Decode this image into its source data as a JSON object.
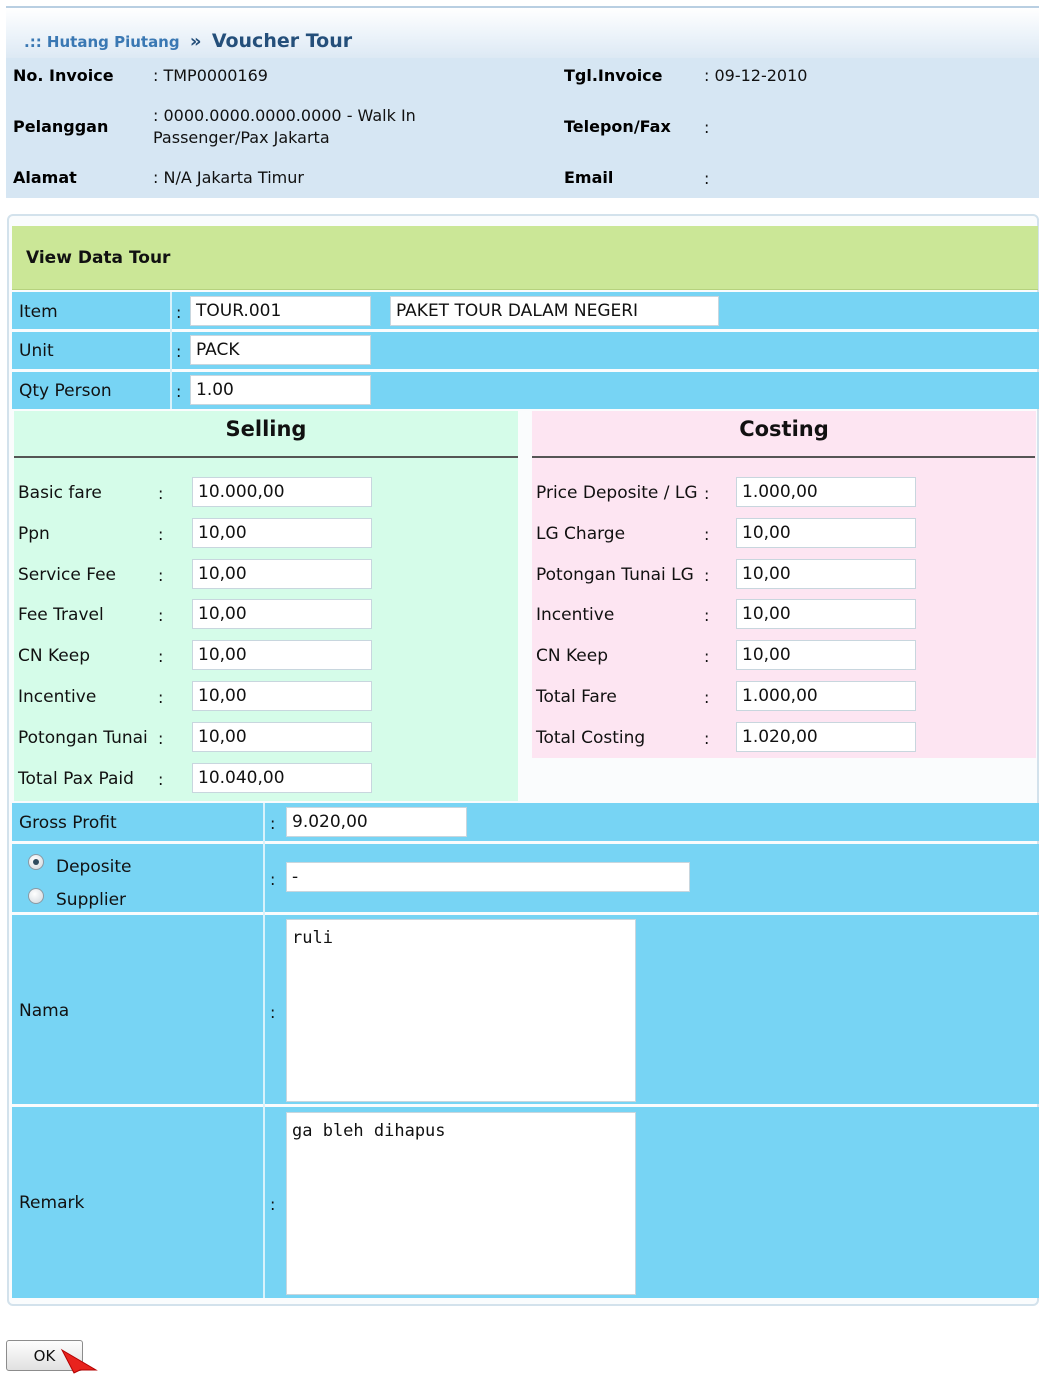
{
  "breadcrumb": {
    "prefix": ".:: Hutang Piutang",
    "separator": "»",
    "current": "Voucher Tour"
  },
  "header": {
    "no_invoice_label": "No. Invoice",
    "no_invoice_value": ": TMP0000169",
    "tgl_invoice_label": "Tgl.Invoice",
    "tgl_invoice_value": ": 09-12-2010",
    "pelanggan_label": "Pelanggan",
    "pelanggan_value_line1": ": 0000.0000.0000.0000 - Walk In",
    "pelanggan_value_line2": "Passenger/Pax Jakarta",
    "telepon_label": "Telepon/Fax",
    "telepon_value": ":",
    "alamat_label": "Alamat",
    "alamat_value": ": N/A Jakarta Timur",
    "email_label": "Email",
    "email_value": ":"
  },
  "panel": {
    "title": "View Data Tour",
    "item_label": "Item",
    "item_code": "TOUR.001",
    "item_name": "PAKET TOUR DALAM NEGERI",
    "unit_label": "Unit",
    "unit_value": "PACK",
    "qty_label": "Qty Person",
    "qty_value": "1.00",
    "colon": ":"
  },
  "selling": {
    "title": "Selling",
    "rows": [
      {
        "label": "Basic fare",
        "value": "10.000,00"
      },
      {
        "label": "Ppn",
        "value": "10,00"
      },
      {
        "label": "Service Fee",
        "value": "10,00"
      },
      {
        "label": "Fee Travel",
        "value": "10,00"
      },
      {
        "label": "CN Keep",
        "value": "10,00"
      },
      {
        "label": "Incentive",
        "value": "10,00"
      },
      {
        "label": "Potongan Tunai",
        "value": "10,00"
      },
      {
        "label": "Total Pax Paid",
        "value": "10.040,00"
      }
    ]
  },
  "costing": {
    "title": "Costing",
    "rows": [
      {
        "label": "Price Deposite / LG",
        "value": "1.000,00"
      },
      {
        "label": "LG Charge",
        "value": "10,00"
      },
      {
        "label": "Potongan Tunai LG",
        "value": "10,00"
      },
      {
        "label": "Incentive",
        "value": "10,00"
      },
      {
        "label": "CN Keep",
        "value": "10,00"
      },
      {
        "label": "Total Fare",
        "value": "1.000,00"
      },
      {
        "label": "Total Costing",
        "value": "1.020,00"
      }
    ]
  },
  "gross_profit": {
    "label": "Gross Profit",
    "value": "9.020,00"
  },
  "payment_source": {
    "options": [
      "Deposite",
      "Supplier"
    ],
    "selected": "Deposite",
    "value": "-"
  },
  "nama": {
    "label": "Nama",
    "value": "ruli"
  },
  "remark": {
    "label": "Remark",
    "value": "ga bleh dihapus"
  },
  "ok_button": "OK",
  "colors": {
    "row_blue": "#77d4f4",
    "title_green": "#cbe797",
    "selling_bg": "#d5fce9",
    "costing_bg": "#fde5f2",
    "header_bg": "#d6e6f3"
  }
}
